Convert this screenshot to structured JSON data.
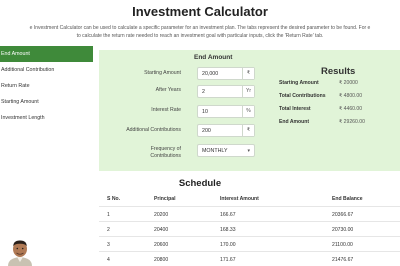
{
  "page": {
    "title": "Investment Calculator",
    "intro_line1": "e Investment Calculator can be used to calculate a specific parameter for an investment plan. The tabs represent the desired parameter to be found. For e",
    "intro_line2": "to calculate the return rate needed to reach an investment goal with particular inputs, click the 'Return Rate' tab."
  },
  "sidebar": {
    "items": [
      {
        "label": "End Amount",
        "active": true
      },
      {
        "label": "Additional Contribution",
        "active": false
      },
      {
        "label": "Return Rate",
        "active": false
      },
      {
        "label": "Starting Amount",
        "active": false
      },
      {
        "label": "Investment Length",
        "active": false
      }
    ]
  },
  "calculator": {
    "heading": "End Amount",
    "fields": {
      "starting_amount": {
        "label": "Starting Amount",
        "value": "20,000",
        "unit": "₹"
      },
      "after_years": {
        "label": "After Years",
        "value": "2",
        "unit": "Yr"
      },
      "interest_rate": {
        "label": "Interest Rate",
        "value": "10",
        "unit": "%"
      },
      "additional_contributions": {
        "label": "Additional Contributions",
        "value": "200",
        "unit": "₹"
      },
      "frequency": {
        "label_line1": "Frequency of",
        "label_line2": "Contributions",
        "value": "MONTHLY",
        "caret": "▾"
      }
    }
  },
  "results": {
    "title": "Results",
    "rows": [
      {
        "label": "Starting Amount",
        "value": "₹ 20000"
      },
      {
        "label": "Total Contributions",
        "value": "₹ 4800.00"
      },
      {
        "label": "Total Interest",
        "value": "₹ 4460.00"
      },
      {
        "label": "End Amount",
        "value": "₹ 29260.00"
      }
    ]
  },
  "schedule": {
    "title": "Schedule",
    "columns": [
      "S No.",
      "Principal",
      "Interest Amount",
      "End Balance"
    ],
    "rows": [
      [
        "1",
        "20200",
        "166.67",
        "20366.67"
      ],
      [
        "2",
        "20400",
        "168.33",
        "20730.00"
      ],
      [
        "3",
        "20600",
        "170.00",
        "21100.00"
      ],
      [
        "4",
        "20800",
        "171.67",
        "21476.67"
      ]
    ]
  },
  "colors": {
    "accent": "#3f8a3a",
    "panel": "#e1f4d8"
  }
}
